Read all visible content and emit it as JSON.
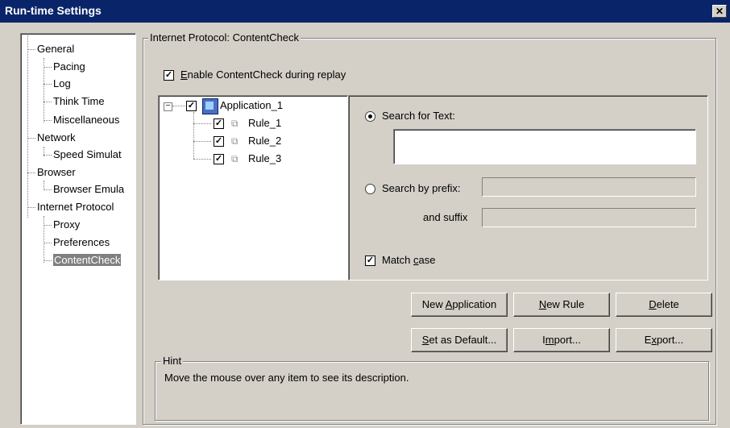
{
  "window": {
    "title": "Run-time Settings",
    "close_glyph": "✕"
  },
  "tree": {
    "items": [
      {
        "label": "General"
      },
      {
        "label": "Pacing"
      },
      {
        "label": "Log"
      },
      {
        "label": "Think Time"
      },
      {
        "label": "Miscellaneous"
      },
      {
        "label": "Network"
      },
      {
        "label": "Speed Simulat"
      },
      {
        "label": "Browser"
      },
      {
        "label": "Browser Emula"
      },
      {
        "label": "Internet Protocol"
      },
      {
        "label": "Proxy"
      },
      {
        "label": "Preferences"
      },
      {
        "label": "ContentCheck"
      }
    ],
    "selected": "ContentCheck"
  },
  "group": {
    "title": "Internet Protocol: ContentCheck"
  },
  "enable": {
    "label_u": "E",
    "label_rest": "nable ContentCheck during replay",
    "checked": true
  },
  "rules_tree": {
    "root": "Application_1",
    "rules": [
      "Rule_1",
      "Rule_2",
      "Rule_3"
    ]
  },
  "search": {
    "text_label": "Search for Text:",
    "text_value": "",
    "prefix_label": "Search by prefix:",
    "suffix_label": "and suffix",
    "match_case_pre": "Match ",
    "match_case_u": "c",
    "match_case_post": "ase"
  },
  "buttons": {
    "new_app_pre": "New ",
    "new_app_u": "A",
    "new_app_post": "pplication",
    "new_rule_u": "N",
    "new_rule_post": "ew Rule",
    "delete_u": "D",
    "delete_post": "elete",
    "set_default_u": "S",
    "set_default_post": "et as Default...",
    "import_pre": "I",
    "import_u": "m",
    "import_post": "port...",
    "export_pre": "E",
    "export_u": "x",
    "export_post": "port..."
  },
  "hint": {
    "title": "Hint",
    "text": "Move the mouse over any item to see its description."
  },
  "colors": {
    "titlebar": "#0a246a",
    "face": "#d4d0c8",
    "selected": "#808080"
  }
}
